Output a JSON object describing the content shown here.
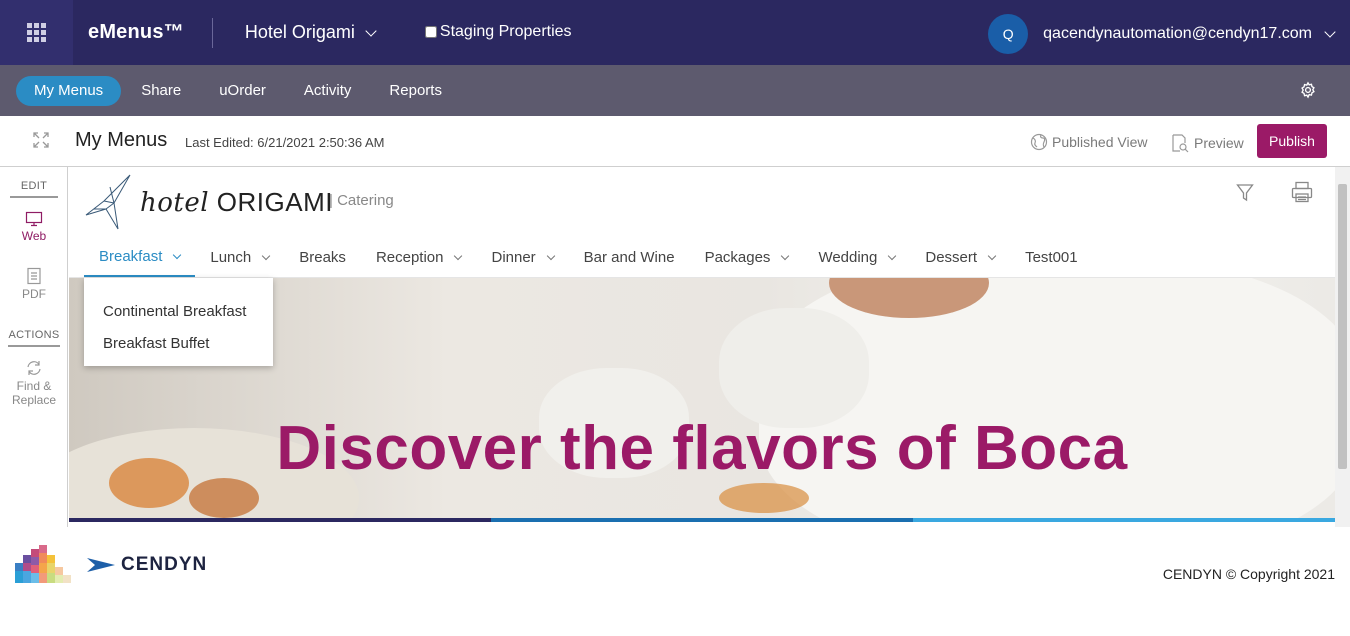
{
  "topbar": {
    "brand": "eMenus™",
    "property": "Hotel Origami",
    "staging_label": "Staging Properties",
    "avatar_initial": "Q",
    "user_email": "qacendynautomation@cendyn17.com",
    "bg_color": "#2b2860"
  },
  "subnav": {
    "tabs": [
      {
        "label": "My Menus",
        "active": true
      },
      {
        "label": "Share"
      },
      {
        "label": "uOrder"
      },
      {
        "label": "Activity"
      },
      {
        "label": "Reports"
      }
    ],
    "settings_icon": "gear-icon"
  },
  "titlebar": {
    "title": "My Menus",
    "last_edited": "Last Edited: 6/21/2021 2:50:36 AM",
    "published_view": "Published View",
    "preview": "Preview",
    "publish": "Publish",
    "publish_color": "#9b1a67"
  },
  "rail": {
    "edit_heading": "EDIT",
    "web": "Web",
    "pdf": "PDF",
    "actions_heading": "ACTIONS",
    "find_replace_line1": "Find &",
    "find_replace_line2": "Replace"
  },
  "menu_site": {
    "logo_script": "hotel",
    "logo_caps": "ORIGAMI",
    "logo_sub": "| Catering",
    "nav": [
      {
        "label": "Breakfast",
        "dropdown": true,
        "active": true
      },
      {
        "label": "Lunch",
        "dropdown": true
      },
      {
        "label": "Breaks",
        "dropdown": false
      },
      {
        "label": "Reception",
        "dropdown": true
      },
      {
        "label": "Dinner",
        "dropdown": true
      },
      {
        "label": "Bar and Wine",
        "dropdown": false
      },
      {
        "label": "Packages",
        "dropdown": true
      },
      {
        "label": "Wedding",
        "dropdown": true
      },
      {
        "label": "Dessert",
        "dropdown": true
      },
      {
        "label": "Test001",
        "dropdown": false
      }
    ],
    "breakfast_dropdown": [
      "Continental Breakfast",
      "Breakfast Buffet"
    ],
    "hero_headline": "Discover the flavors of Boca",
    "hero_color": "#9b1a67",
    "hero_bar_colors": [
      "#2b2860",
      "#1a6fb0",
      "#3aa8e0"
    ],
    "active_color": "#2b8cc4"
  },
  "footer": {
    "logo_text": "CENDYN",
    "copyright": "CENDYN © Copyright 2021"
  }
}
